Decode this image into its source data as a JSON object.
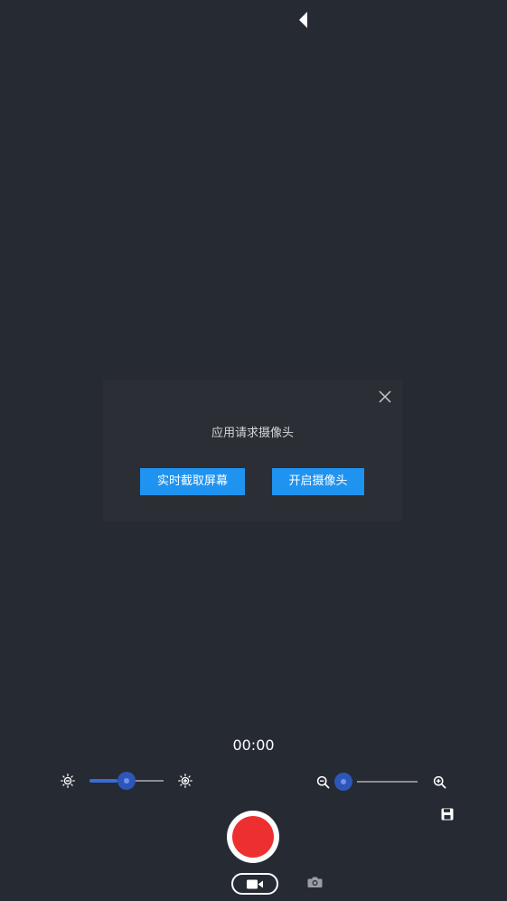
{
  "nav": {
    "back_icon": "triangle-left-icon"
  },
  "dialog": {
    "message": "应用请求摄像头",
    "close_icon": "close-icon",
    "screen_button_label": "实时截取屏幕",
    "camera_button_label": "开启摄像头",
    "accent_color": "#1f93f0"
  },
  "recorder": {
    "timer": "00:00",
    "brightness": {
      "decrease_icon": "brightness-low-icon",
      "increase_icon": "brightness-high-icon",
      "value_fraction": 0.5
    },
    "zoom": {
      "decrease_icon": "zoom-out-icon",
      "increase_icon": "zoom-in-icon",
      "value_fraction": 0.0
    },
    "save_icon": "save-icon",
    "record_icon": "record-button-icon",
    "record_color": "#ee2f2f",
    "modes": {
      "video_icon": "video-camera-icon",
      "photo_icon": "photo-camera-icon",
      "selected": "video"
    }
  }
}
